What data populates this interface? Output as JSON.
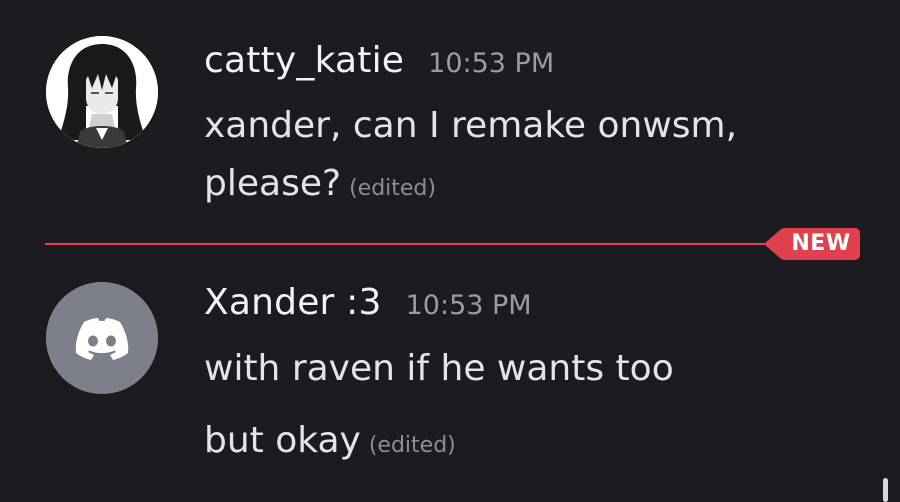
{
  "messages": [
    {
      "username": "catty_katie",
      "timestamp": "10:53 PM",
      "lines": [
        "xander, can I remake onwsm,",
        "please?"
      ],
      "edited_label": "(edited)",
      "avatar_icon": "anime-girl-avatar-icon"
    },
    {
      "username": "Xander :3",
      "timestamp": "10:53 PM",
      "lines": [
        "with raven if he wants too",
        "but okay"
      ],
      "edited_label": "(edited)",
      "avatar_icon": "discord-default-avatar-icon"
    }
  ],
  "divider": {
    "label": "NEW",
    "color": "#e0414f"
  },
  "colors": {
    "background": "#1c1c20",
    "username": "#f2f3f5",
    "timestamp": "#9a9ca3",
    "default_avatar": "#7d808a"
  }
}
